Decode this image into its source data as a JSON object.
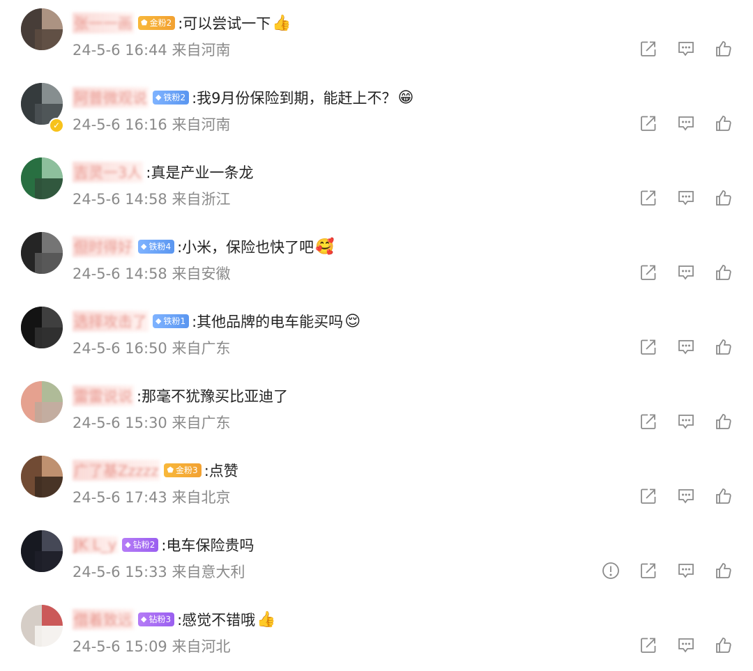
{
  "comments": [
    {
      "user": "张一一画",
      "badge": "金粉2",
      "badge_type": "gold",
      "text": ":可以尝试一下",
      "emoji": "👍",
      "time": "24-5-6 16:44",
      "location": "来自河南",
      "report": false,
      "avatar": {
        "bg": "#7a6a62",
        "blocks": [
          "#3e3531",
          "#b59a88",
          "#5d4b41"
        ]
      }
    },
    {
      "user": "阿普微观说",
      "badge": "铁粉2",
      "badge_type": "iron",
      "text": ":我9月份保险到期，能赶上不？",
      "emoji": "😁",
      "time": "24-5-6 16:16",
      "location": "来自河南",
      "report": false,
      "verified": true,
      "avatar": {
        "bg": "#5d6668",
        "blocks": [
          "#2e3436",
          "#8d9597",
          "#4c5456"
        ]
      }
    },
    {
      "user": "吉灵一3人",
      "badge": "",
      "badge_type": "",
      "text": ":真是产业一条龙",
      "emoji": "",
      "time": "24-5-6 14:58",
      "location": "来自浙江",
      "report": false,
      "avatar": {
        "bg": "#3d8a58",
        "blocks": [
          "#256a3d",
          "#9bc8a8",
          "#2f4f3a"
        ]
      }
    },
    {
      "user": "但时得好",
      "badge": "铁粉4",
      "badge_type": "iron",
      "text": ":小米，保险也快了吧",
      "emoji": "🥰",
      "time": "24-5-6 14:58",
      "location": "来自安徽",
      "report": false,
      "avatar": {
        "bg": "#4d4d4d",
        "blocks": [
          "#1f1f1f",
          "#7c7c7c",
          "#5a5a5a"
        ]
      }
    },
    {
      "user": "选择攻击了",
      "badge": "铁粉1",
      "badge_type": "iron",
      "text": ":其他品牌的电车能买吗",
      "emoji": "😌",
      "time": "24-5-6 16:50",
      "location": "来自广东",
      "report": false,
      "avatar": {
        "bg": "#262626",
        "blocks": [
          "#111111",
          "#444444",
          "#333333"
        ]
      }
    },
    {
      "user": "雷雷说说",
      "badge": "",
      "badge_type": "",
      "text": ":那毫不犹豫买比亚迪了",
      "emoji": "",
      "time": "24-5-6 15:30",
      "location": "来自广东",
      "report": false,
      "avatar": {
        "bg": "#d8c8c0",
        "blocks": [
          "#e89a86",
          "#a8b890",
          "#c0a89a"
        ]
      }
    },
    {
      "user": "广了基Zzzzz",
      "badge": "金粉3",
      "badge_type": "gold",
      "text": ":点赞",
      "emoji": "",
      "time": "24-5-6 17:43",
      "location": "来自北京",
      "report": false,
      "avatar": {
        "bg": "#9a6b4a",
        "blocks": [
          "#6a4530",
          "#c69877",
          "#3a2a20"
        ]
      }
    },
    {
      "user": "JK L_y",
      "badge": "钻粉2",
      "badge_type": "diamond",
      "text": ":电车保险贵吗",
      "emoji": "",
      "time": "24-5-6 15:33",
      "location": "来自意大利",
      "report": true,
      "avatar": {
        "bg": "#2a2d38",
        "blocks": [
          "#14161d",
          "#4a4e5c",
          "#1e2029"
        ]
      }
    },
    {
      "user": "借着致远",
      "badge": "钻粉3",
      "badge_type": "diamond",
      "text": ":感觉不错哦",
      "emoji": "👍",
      "time": "24-5-6 15:09",
      "location": "来自河北",
      "report": false,
      "avatar": {
        "bg": "#eeeae6",
        "blocks": [
          "#d0c8c0",
          "#c44040",
          "#f6f3f0"
        ]
      }
    }
  ],
  "icons": {
    "share": "share-icon",
    "comment": "comment-icon",
    "like": "like-icon",
    "report": "report-icon"
  },
  "colors": {
    "username": "#e8978e",
    "meta": "#8a8a8a",
    "text": "#222222",
    "gold": "#f2a132",
    "iron": "#5a96f0",
    "diamond": "#9a5ff0"
  }
}
